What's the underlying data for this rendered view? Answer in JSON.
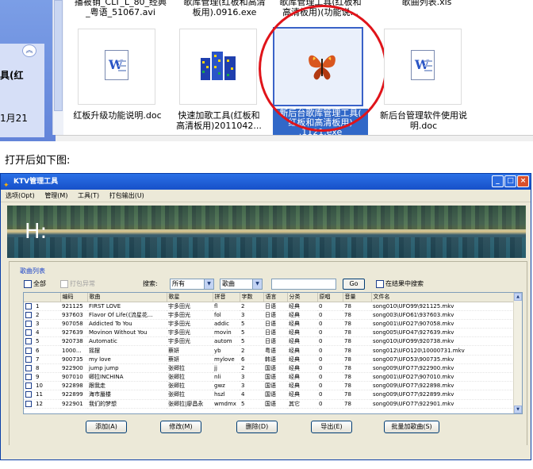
{
  "explorer": {
    "top_labels": [
      {
        "text": "播被销_CLT_L_80_经典\n_粤语_51067.avi"
      },
      {
        "text": "歌库管理(红板和高清\n板用).0916.exe"
      },
      {
        "text": "歌库管理工具(红板和\n高清板用)(功能说..."
      },
      {
        "text": "歌曲列表.xls"
      }
    ],
    "side_label_1": "具(红",
    "side_label_2": "1月21",
    "chevron": "︽",
    "files": [
      {
        "name": "红板升级功能说明.doc",
        "icon": "word-doc-icon"
      },
      {
        "name": "快速加歌工具(红板和\n高清板用)2011042...",
        "icon": "app-grid-icon"
      },
      {
        "name": "新后台歌库管理工具(\n红板和高清板用)\n.1121.exe",
        "icon": "butterfly-icon"
      },
      {
        "name": "新后台管理软件使用说\n明.doc",
        "icon": "word-doc-icon"
      }
    ]
  },
  "caption": "打开后如下图:",
  "app": {
    "title": "KTV管理工具",
    "title_buttons": [
      "_",
      "□",
      "×"
    ],
    "menu": [
      "选项(Opt)",
      "管理(M)",
      "工具(T)",
      "打包输出(U)"
    ],
    "banner_label": "H:",
    "group_title": "歌曲列表",
    "select_all": "全部",
    "pack_error": "打包异常",
    "search_label": "搜索:",
    "filter_value": "所有",
    "field_value": "歌曲",
    "search_value": "",
    "go_label": "Go",
    "in_results": "在结果中搜索",
    "columns": [
      "",
      "编码",
      "歌曲",
      "歌星",
      "拼音",
      "字数",
      "语言",
      "分类",
      "原唱",
      "音量",
      "文件名"
    ],
    "rows": [
      [
        "1",
        "921125",
        "FIRST LOVE",
        "宇多田光",
        "fl",
        "2",
        "日语",
        "经典",
        "0",
        "78",
        "song010\\UFO99\\921125.mkv"
      ],
      [
        "2",
        "937603",
        "Flavor Of Life(《流星花...",
        "宇多田光",
        "fol",
        "3",
        "日语",
        "经典",
        "0",
        "78",
        "song003\\UFO61\\937603.mkv"
      ],
      [
        "3",
        "907058",
        "Addicted To You",
        "宇多田光",
        "addic",
        "5",
        "日语",
        "经典",
        "0",
        "78",
        "song001\\UFO27\\907058.mkv"
      ],
      [
        "4",
        "927639",
        "Movinon Without You",
        "宇多田光",
        "movin",
        "5",
        "日语",
        "经典",
        "0",
        "78",
        "song005\\UFO47\\927639.mkv"
      ],
      [
        "5",
        "920738",
        "Automatic",
        "宇多田光",
        "autom",
        "5",
        "日语",
        "经典",
        "0",
        "78",
        "song010\\UFO99\\920738.mkv"
      ],
      [
        "6",
        "1000...",
        "摇摆",
        "蔡妍",
        "yb",
        "2",
        "粤语",
        "经典",
        "0",
        "78",
        "song012\\UFO120\\10000731.mkv"
      ],
      [
        "7",
        "900735",
        "my love",
        "蔡妍",
        "mylove",
        "6",
        "韩语",
        "经典",
        "0",
        "78",
        "song007\\UFO53\\900735.mkv"
      ],
      [
        "8",
        "922900",
        "jump jump",
        "张卿拉",
        "jj",
        "2",
        "国语",
        "经典",
        "0",
        "78",
        "song009\\UFO77\\922900.mkv"
      ],
      [
        "9",
        "907010",
        "卿拉INCHINA",
        "张卿拉",
        "nli",
        "3",
        "国语",
        "经典",
        "0",
        "78",
        "song001\\UFO27\\907010.mkv"
      ],
      [
        "10",
        "922898",
        "跟我走",
        "张卿拉",
        "gwz",
        "3",
        "国语",
        "经典",
        "0",
        "78",
        "song009\\UFO77\\922898.mkv"
      ],
      [
        "11",
        "922899",
        "海市蜃楼",
        "张卿拉",
        "hszl",
        "4",
        "国语",
        "经典",
        "0",
        "78",
        "song009\\UFO77\\922899.mkv"
      ],
      [
        "12",
        "922901",
        "我们的梦想",
        "张卿拉|廖昌永",
        "wmdmx",
        "5",
        "国语",
        "其它",
        "0",
        "78",
        "song009\\UFO77\\922901.mkv"
      ]
    ],
    "buttons": [
      "添加(A)",
      "修改(M)",
      "删除(D)",
      "导出(E)",
      "批量加歌曲(S)"
    ]
  }
}
